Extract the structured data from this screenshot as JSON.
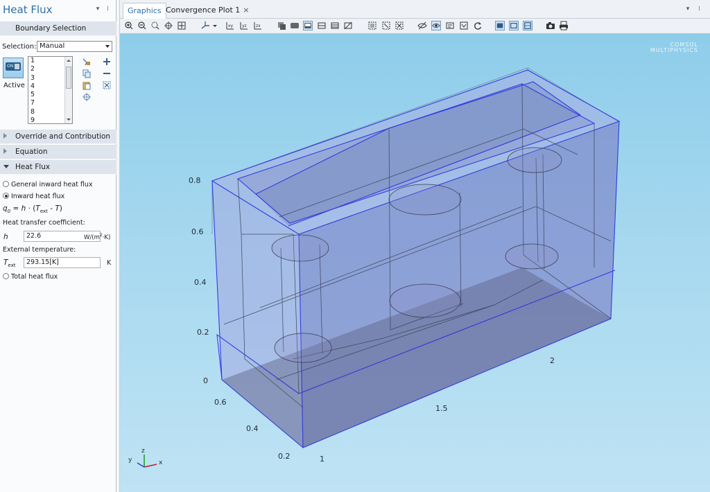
{
  "settings": {
    "title": "Heat Flux",
    "sections": {
      "boundary_selection": "Boundary Selection",
      "override": "Override and Contribution",
      "equation": "Equation",
      "heat_flux": "Heat Flux"
    },
    "selection_label": "Selection:",
    "selection_value": "Manual",
    "active_label": "Active",
    "active_toggle_text": "ON",
    "boundaries": [
      "1",
      "2",
      "3",
      "4",
      "5",
      "7",
      "8",
      "9"
    ],
    "options": {
      "general": "General inward heat flux",
      "inward": "Inward heat flux",
      "total": "Total heat flux"
    },
    "selected_option": "inward",
    "formula": {
      "q": "q",
      "q_sub": "0",
      "eq": " = ",
      "h": "h",
      "dot": " · (",
      "T": "T",
      "T_sub": "ext",
      "minus": " - ",
      "T2": "T",
      "close": ")"
    },
    "htc_label": "Heat transfer coefficient:",
    "h_symbol": "h",
    "h_value": "22.6",
    "h_unit_pre": "W/(m",
    "h_unit_sup": "2",
    "h_unit_post": "·K)",
    "ext_temp_label": "External temperature:",
    "T_symbol": "T",
    "T_sub": "ext",
    "T_value": "293.15[K]",
    "T_unit": "K"
  },
  "graphics": {
    "tabs": [
      {
        "label": "Graphics",
        "active": true
      },
      {
        "label": "Convergence Plot 1",
        "active": false,
        "closable": true
      }
    ],
    "close_glyph": "×",
    "brand_line1": "COMSOL",
    "brand_line2": "MULTIPHYSICS",
    "axis_labels": {
      "z": [
        "0.8",
        "0.6",
        "0.4",
        "0.2",
        "0"
      ],
      "y": [
        "0.6",
        "0.4",
        "0.2"
      ],
      "x": [
        "1",
        "1.5",
        "2"
      ]
    },
    "triad": {
      "x": "x",
      "y": "y",
      "z": "z"
    },
    "colors": {
      "accent": "#2c6fa8",
      "bg_top": "#8ecdea",
      "bg_bottom": "#bfe3f4",
      "geometry_fill": "#8f92d6",
      "edge_highlight": "#2a2ee0"
    }
  }
}
